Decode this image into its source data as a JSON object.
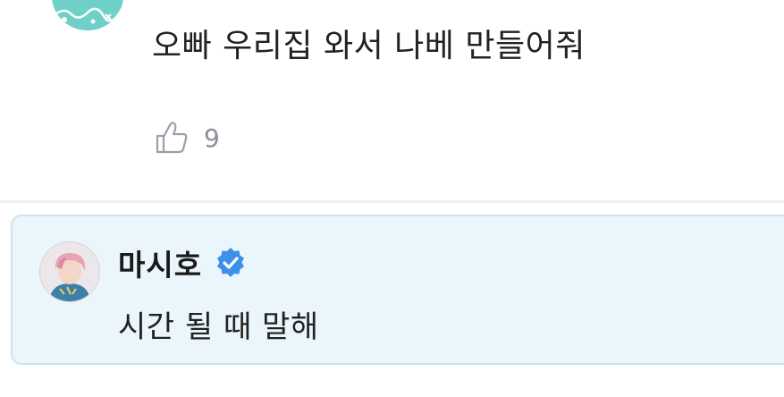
{
  "comment": {
    "text": "오빠 우리집 와서 나베 만들어줘",
    "like_count": "9",
    "like_icon": "thumbs-up-icon"
  },
  "reply": {
    "author": "마시호",
    "verified_icon": "verified-badge-icon",
    "text": "시간 될 때 말해"
  },
  "colors": {
    "reply_background": "#eaf6fb",
    "reply_border": "#cfe3ec",
    "verified_blue": "#3d8fe8",
    "like_gray": "#8a8f99"
  }
}
